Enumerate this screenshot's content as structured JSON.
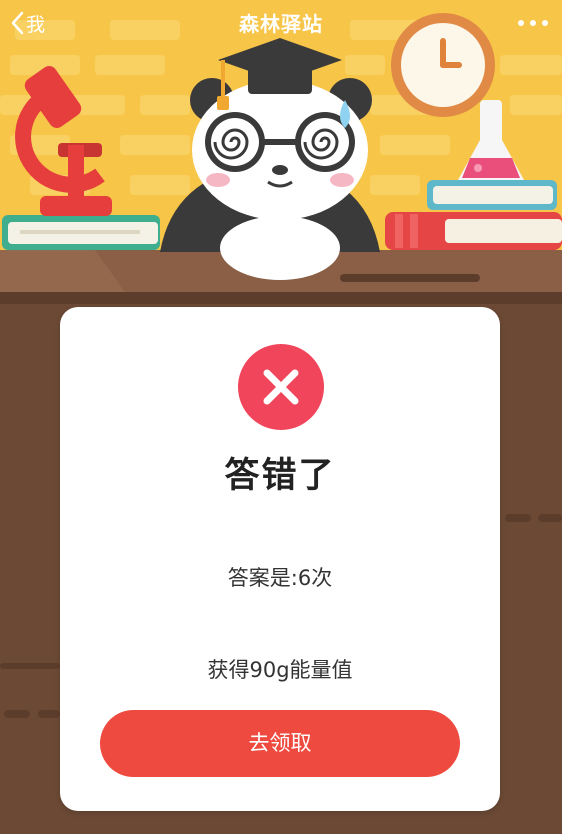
{
  "nav": {
    "back_label": "我",
    "title": "森林驿站"
  },
  "result": {
    "title": "答错了",
    "answer_text": "答案是:6次",
    "reward_text": "获得90g能量值",
    "claim_button": "去领取"
  },
  "colors": {
    "wall": "#f7c548",
    "desk": "#7a523c",
    "error_red": "#f0455a",
    "button_red": "#ee4a3f"
  }
}
